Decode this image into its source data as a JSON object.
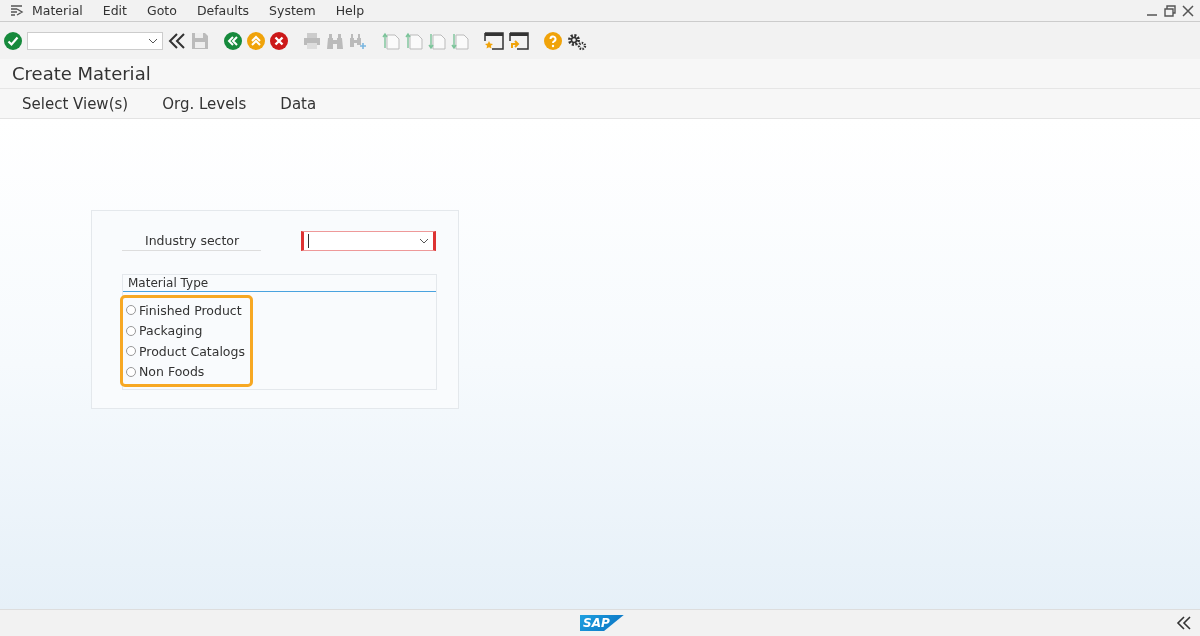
{
  "menu_bar": {
    "items": [
      {
        "label": "Material"
      },
      {
        "label": "Edit"
      },
      {
        "label": "Goto"
      },
      {
        "label": "Defaults"
      },
      {
        "label": "System"
      },
      {
        "label": "Help"
      }
    ]
  },
  "title": "Create Material",
  "app_toolbar": {
    "items": [
      {
        "label": "Select View(s)"
      },
      {
        "label": "Org. Levels"
      },
      {
        "label": "Data"
      }
    ]
  },
  "form": {
    "industry_sector": {
      "label": "Industry sector",
      "required": true
    },
    "material_type": {
      "title": "Material Type",
      "highlighted": true,
      "options": [
        {
          "label": "Finished Product",
          "selected": false
        },
        {
          "label": "Packaging",
          "selected": false
        },
        {
          "label": "Product Catalogs",
          "selected": false
        },
        {
          "label": "Non Foods",
          "selected": false
        }
      ]
    }
  },
  "footer": {
    "logo": "SAP"
  }
}
